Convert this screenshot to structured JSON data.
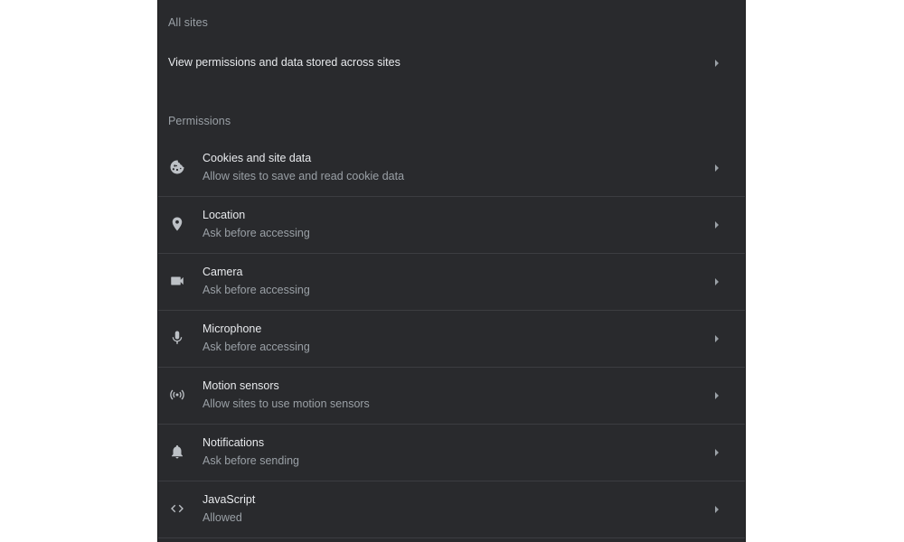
{
  "all_sites": {
    "header": "All sites",
    "view_label": "View permissions and data stored across sites"
  },
  "permissions": {
    "header": "Permissions",
    "items": [
      {
        "title": "Cookies and site data",
        "subtitle": "Allow sites to save and read cookie data",
        "icon": "cookie-icon"
      },
      {
        "title": "Location",
        "subtitle": "Ask before accessing",
        "icon": "location-pin-icon"
      },
      {
        "title": "Camera",
        "subtitle": "Ask before accessing",
        "icon": "camera-icon"
      },
      {
        "title": "Microphone",
        "subtitle": "Ask before accessing",
        "icon": "microphone-icon"
      },
      {
        "title": "Motion sensors",
        "subtitle": "Allow sites to use motion sensors",
        "icon": "motion-sensors-icon"
      },
      {
        "title": "Notifications",
        "subtitle": "Ask before sending",
        "icon": "bell-icon"
      },
      {
        "title": "JavaScript",
        "subtitle": "Allowed",
        "icon": "code-icon"
      }
    ]
  },
  "colors": {
    "panel_background": "#292a2d",
    "primary_text": "#e8eaed",
    "secondary_text": "#9aa0a6",
    "divider": "#3c3d41"
  }
}
